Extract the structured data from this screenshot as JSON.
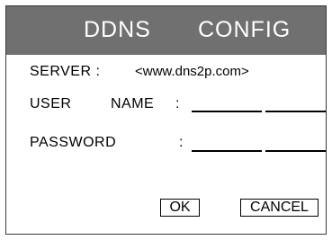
{
  "dialog": {
    "title_word_1": "DDNS",
    "title_word_2": "CONFIG",
    "server_label": "SERVER :",
    "server_value": "<www.dns2p.com>",
    "user_label_1": "USER",
    "user_label_2": "NAME",
    "user_colon": ":",
    "user_value": "",
    "password_label": "PASSWORD",
    "password_colon": ":",
    "password_value": "",
    "ok_label": "OK",
    "cancel_label": "CANCEL"
  },
  "colors": {
    "title_bar": "#707070",
    "title_text": "#ffffff",
    "border": "#3a3a3a"
  }
}
